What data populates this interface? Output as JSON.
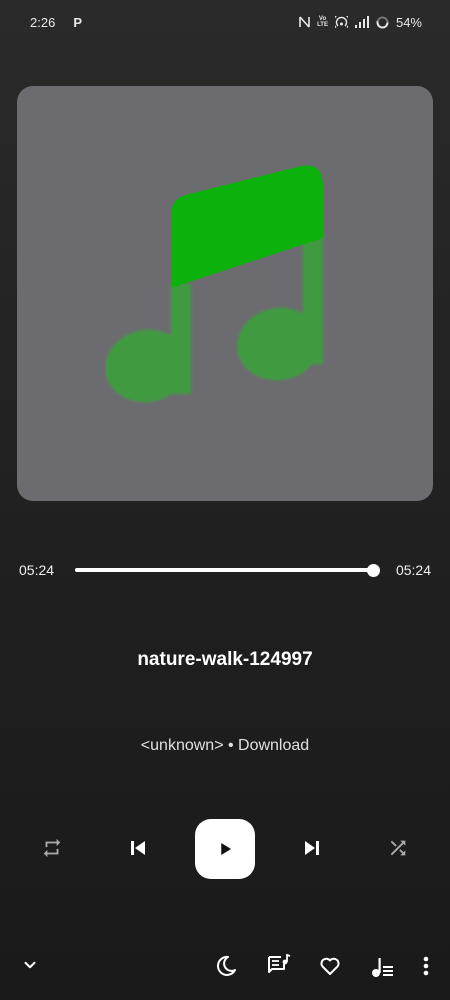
{
  "status_bar": {
    "time": "2:26",
    "app_indicator": "P",
    "volte_line1": "Vo",
    "volte_line2": "LTE",
    "battery": "54%",
    "icons": [
      "nfc-icon",
      "volte-icon",
      "hotspot-icon",
      "signal-icon",
      "battery-icon"
    ]
  },
  "album_art": {
    "icon": "music-note-icon",
    "background_color": "#6c6c70",
    "note_color": "#0cb10c"
  },
  "progress": {
    "elapsed": "05:24",
    "total": "05:24",
    "fraction": 1.0
  },
  "track": {
    "title": "nature-walk-124997",
    "subtitle": "<unknown> • Download"
  },
  "controls": {
    "repeat_icon": "repeat-icon",
    "previous_icon": "skip-previous-icon",
    "play_icon": "play-icon",
    "next_icon": "skip-next-icon",
    "shuffle_icon": "shuffle-icon"
  },
  "bottom_bar": {
    "icons": [
      "chevron-down-icon",
      "sleep-timer-moon-icon",
      "lyrics-icon",
      "heart-icon",
      "queue-icon",
      "more-vertical-icon"
    ]
  },
  "colors": {
    "accent": "#0cb10c",
    "text": "#ffffff",
    "background": "#222222"
  }
}
